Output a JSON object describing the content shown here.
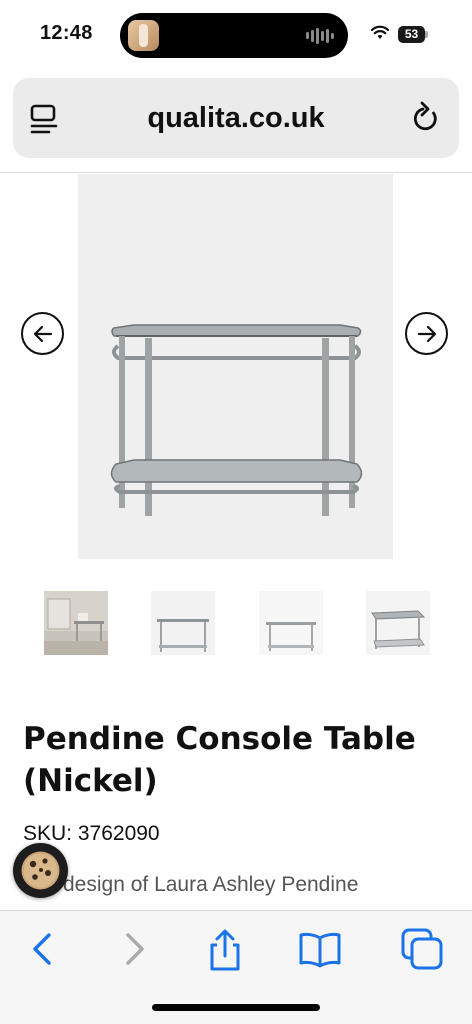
{
  "status_bar": {
    "time": "12:48",
    "battery": "53"
  },
  "browser": {
    "url": "qualita.co.uk"
  },
  "product": {
    "title_line1": "Pendine Console Table",
    "title_line2": "(Nickel)",
    "sku_label": "SKU:",
    "sku_value": "3762090",
    "description_snippet": "design of Laura Ashley Pendine"
  },
  "gallery": {
    "thumbnails": [
      "room-scene",
      "console-front",
      "console-front-alt",
      "console-angle"
    ]
  },
  "icons": {
    "reader": "reader-mode-icon",
    "reload": "reload-icon",
    "prev": "arrow-left-icon",
    "next": "arrow-right-icon",
    "cookie": "cookie-icon",
    "back": "back-chevron-icon",
    "forward": "forward-chevron-icon",
    "share": "share-icon",
    "bookmarks": "bookmarks-icon",
    "tabs": "tabs-icon"
  },
  "colors": {
    "accent": "#1a73e8",
    "disabled": "#a9a9a9",
    "text": "#111111"
  }
}
